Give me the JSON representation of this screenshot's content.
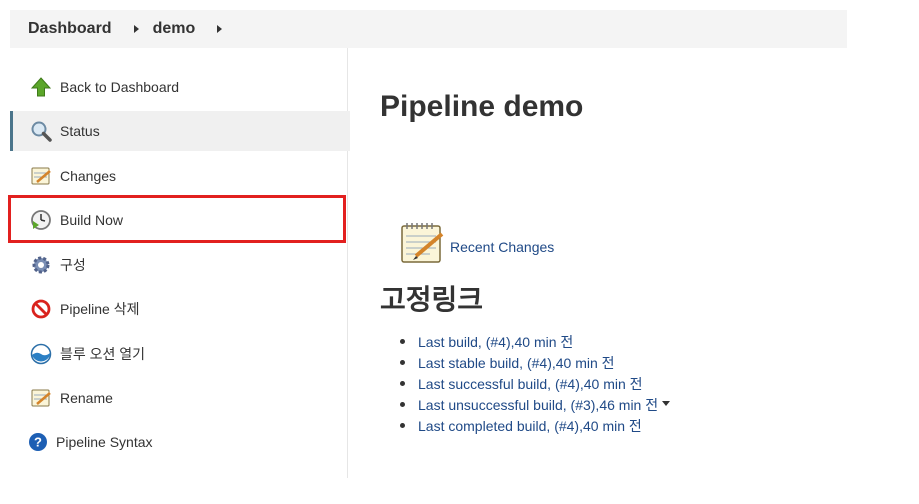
{
  "breadcrumb": {
    "items": [
      "Dashboard",
      "demo"
    ]
  },
  "sidebar": {
    "items": [
      {
        "label": "Back to Dashboard",
        "icon": "arrow-up-icon"
      },
      {
        "label": "Status",
        "icon": "magnifier-icon",
        "active": true
      },
      {
        "label": "Changes",
        "icon": "notepad-icon"
      },
      {
        "label": "Build Now",
        "icon": "clock-play-icon",
        "highlighted": true
      },
      {
        "label": "구성",
        "icon": "gear-icon"
      },
      {
        "label": "Pipeline 삭제",
        "icon": "no-entry-icon"
      },
      {
        "label": "블루 오션 열기",
        "icon": "blue-ocean-icon"
      },
      {
        "label": "Rename",
        "icon": "notepad-icon"
      },
      {
        "label": "Pipeline Syntax",
        "icon": "help-icon"
      }
    ]
  },
  "main": {
    "title": "Pipeline demo",
    "recent_changes": "Recent Changes",
    "permalinks_title": "고정링크",
    "permalinks": [
      "Last build, (#4),40 min 전",
      "Last stable build, (#4),40 min 전",
      "Last successful build, (#4),40 min 전",
      "Last unsuccessful build, (#3),46 min 전",
      "Last completed build, (#4),40 min 전"
    ]
  },
  "colors": {
    "link": "#204a87",
    "highlight_border": "#e2201f",
    "active_bg": "#f0f0f0"
  }
}
